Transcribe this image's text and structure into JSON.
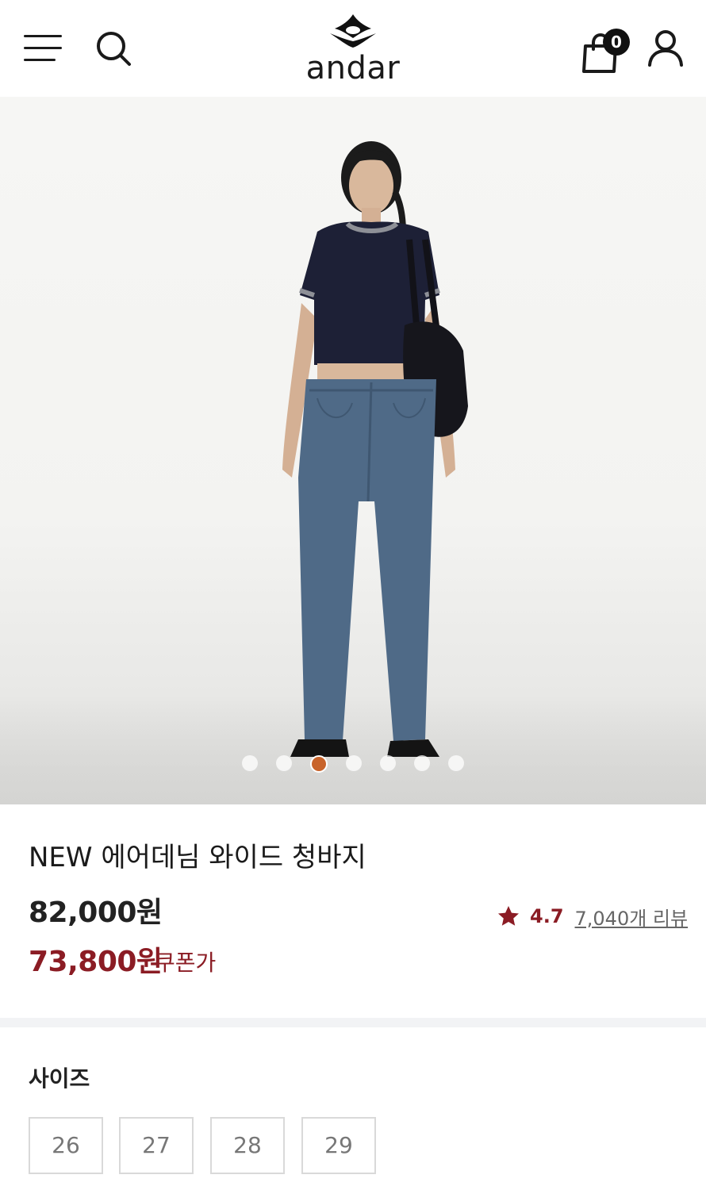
{
  "header": {
    "logo_text": "andar",
    "cart_count": "0"
  },
  "carousel": {
    "dot_count": 7,
    "active_index": 2,
    "active_color": "#c8632a"
  },
  "product": {
    "name": "NEW 에어데님 와이드 청바지",
    "price_original": "82,000원",
    "price_sale": "73,800원",
    "coupon_label": "쿠폰가",
    "rating": "4.7",
    "review_link": "7,040개 리뷰",
    "accent_color": "#8b1c24"
  },
  "size": {
    "title": "사이즈",
    "options": [
      "26",
      "27",
      "28",
      "29"
    ]
  }
}
